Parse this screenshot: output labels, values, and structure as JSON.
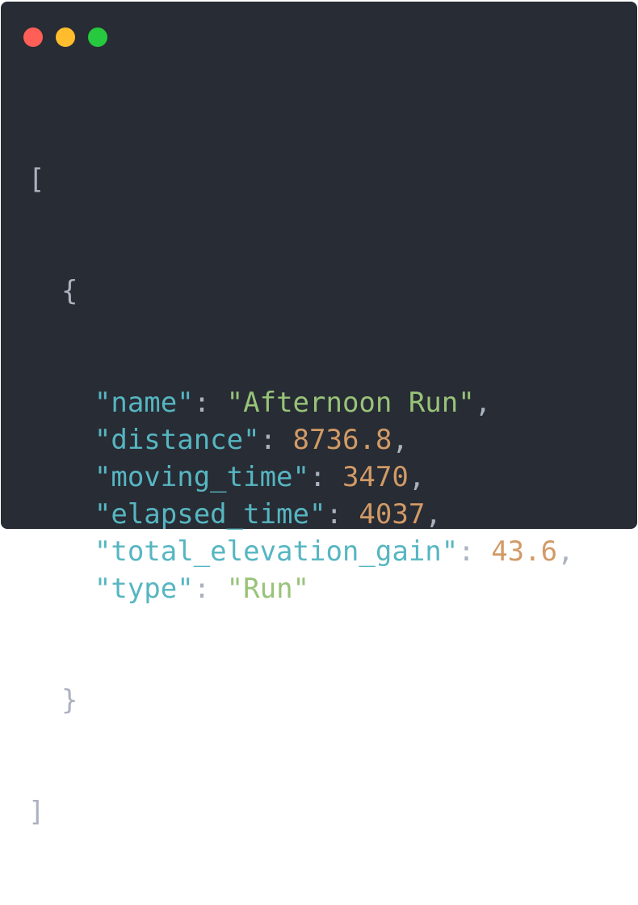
{
  "window": {
    "controls": {
      "close_icon": "red-dot",
      "minimize_icon": "yellow-dot",
      "zoom_icon": "green-dot"
    }
  },
  "code": {
    "open_bracket": "[",
    "open_brace": "{",
    "close_brace": "}",
    "close_bracket": "]",
    "entries": [
      {
        "key": "\"name\"",
        "value": "\"Afternoon Run\"",
        "value_type": "string",
        "trailing_comma": true
      },
      {
        "key": "\"distance\"",
        "value": "8736.8",
        "value_type": "number",
        "trailing_comma": true
      },
      {
        "key": "\"moving_time\"",
        "value": "3470",
        "value_type": "number",
        "trailing_comma": true
      },
      {
        "key": "\"elapsed_time\"",
        "value": "4037",
        "value_type": "number",
        "trailing_comma": true
      },
      {
        "key": "\"total_elevation_gain\"",
        "value": "43.6",
        "value_type": "number",
        "trailing_comma": true
      },
      {
        "key": "\"type\"",
        "value": "\"Run\"",
        "value_type": "string",
        "trailing_comma": false
      }
    ],
    "colors": {
      "background": "#282c34",
      "punctuation": "#abb2bf",
      "key": "#56b6c2",
      "string": "#98c379",
      "number": "#d19a66"
    }
  }
}
